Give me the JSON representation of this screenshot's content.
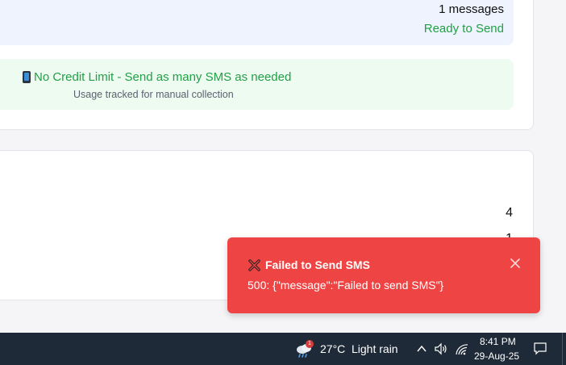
{
  "summary": {
    "message_count": "1 messages",
    "status": "Ready to Send"
  },
  "credit": {
    "headline": "No Credit Limit - Send as many SMS as needed",
    "subtext": "Usage tracked for manual collection"
  },
  "second_card": {
    "value_1": "4",
    "value_2": "1"
  },
  "toast": {
    "title": "Failed to Send SMS",
    "message": "500: {\"message\":\"Failed to send SMS\"}"
  },
  "taskbar": {
    "weather_badge": "1",
    "temperature": "27°C",
    "condition": "Light rain",
    "time": "8:41 PM",
    "date": "29-Aug-25"
  },
  "colors": {
    "success": "#22a046",
    "error": "#ef4444",
    "taskbar": "#1f2a38"
  }
}
